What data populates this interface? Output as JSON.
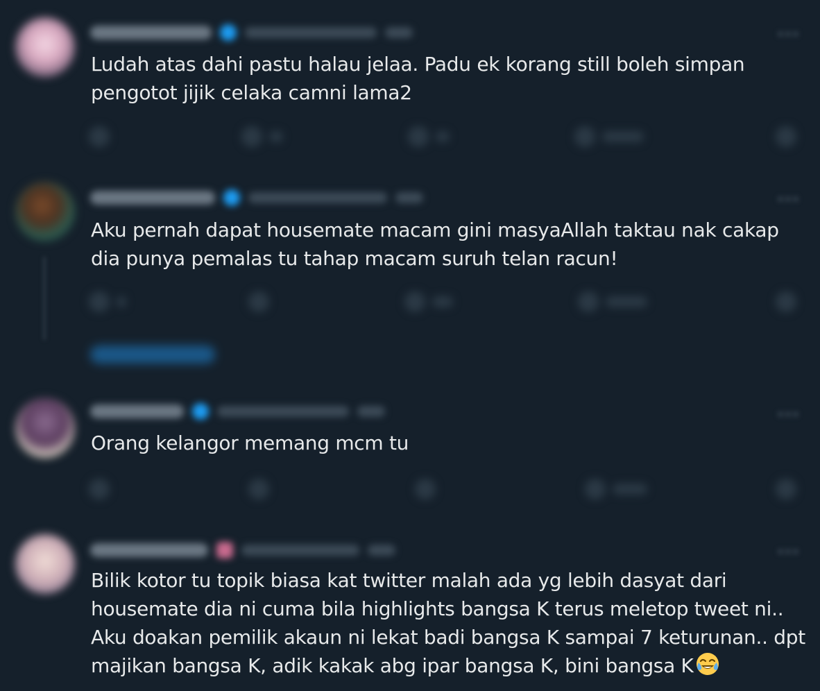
{
  "tweets": [
    {
      "text": "Ludah atas dahi pastu halau jelaa. Padu ek korang still boleh simpan\npengotot jijik celaka camni lama2"
    },
    {
      "text": "Aku pernah dapat housemate macam gini masyaAllah taktau nak cakap\ndia punya pemalas tu tahap macam suruh telan racun!"
    },
    {
      "text": "Orang kelangor memang mcm tu"
    },
    {
      "text": "Bilik kotor tu topik biasa kat twitter malah ada yg lebih dasyat dari\nhousemate dia ni cuma bila highlights bangsa K terus meletop tweet ni..\nAku doakan pemilik akaun ni lekat badi bangsa K sampai 7 keturunan.. dpt\nmajikan bangsa K, adik kakak abg ipar bangsa K, bini bangsa K"
    }
  ],
  "icons": {
    "avatar": "avatar",
    "verified": "verified-badge-icon",
    "more": "more-options-icon",
    "reply": "reply-icon",
    "retweet": "retweet-icon",
    "like": "like-icon",
    "views": "views-icon",
    "share": "share-icon",
    "emoji": "face-with-tears-of-joy-emoji"
  },
  "colors": {
    "background": "#15202b",
    "text": "#e7e9ea",
    "accent": "#1d9bf0"
  }
}
